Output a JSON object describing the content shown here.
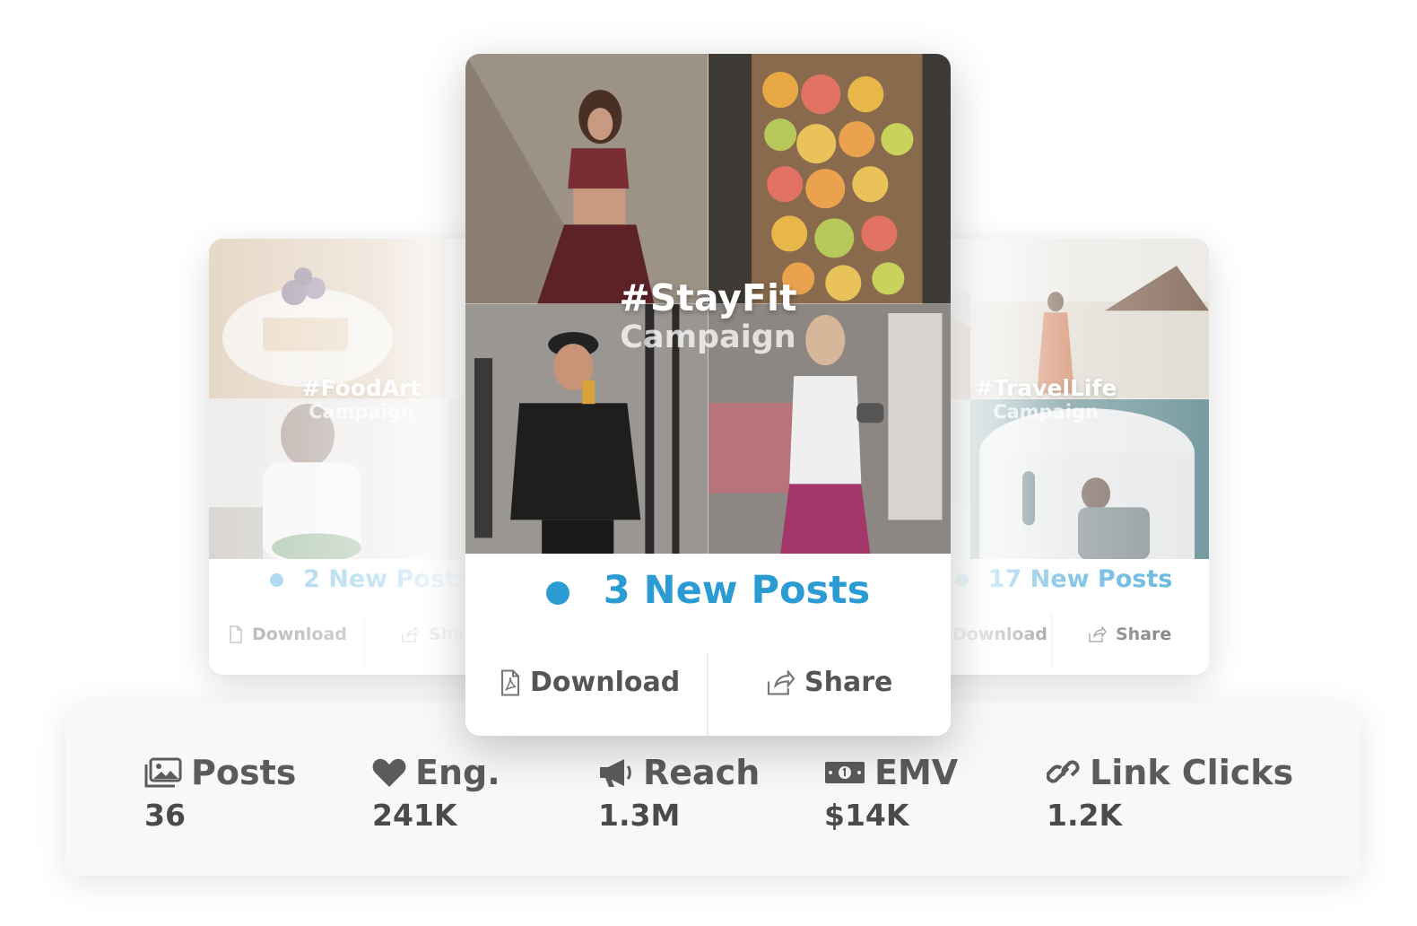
{
  "cards": {
    "left": {
      "hashtag": "#FoodArt",
      "subtitle": "Campaign",
      "new_posts": "2 New Posts",
      "download_label": "Download",
      "share_label": "Share"
    },
    "center": {
      "hashtag": "#StayFit",
      "subtitle": "Campaign",
      "new_posts": "3 New Posts",
      "download_label": "Download",
      "share_label": "Share"
    },
    "right": {
      "hashtag": "#TravelLife",
      "subtitle": "Campaign",
      "new_posts": "17 New Posts",
      "download_label": "Download",
      "share_label": "Share"
    }
  },
  "stats": [
    {
      "icon": "images-icon",
      "label": "Posts",
      "value": "36"
    },
    {
      "icon": "heart-icon",
      "label": "Eng.",
      "value": "241K"
    },
    {
      "icon": "megaphone-icon",
      "label": "Reach",
      "value": "1.3M"
    },
    {
      "icon": "money-icon",
      "label": "EMV",
      "value": "$14K"
    },
    {
      "icon": "link-icon",
      "label": "Link Clicks",
      "value": "1.2K"
    }
  ],
  "colors": {
    "accent": "#2b9bd3",
    "text": "#555555",
    "panel": "#f7f8f9"
  }
}
